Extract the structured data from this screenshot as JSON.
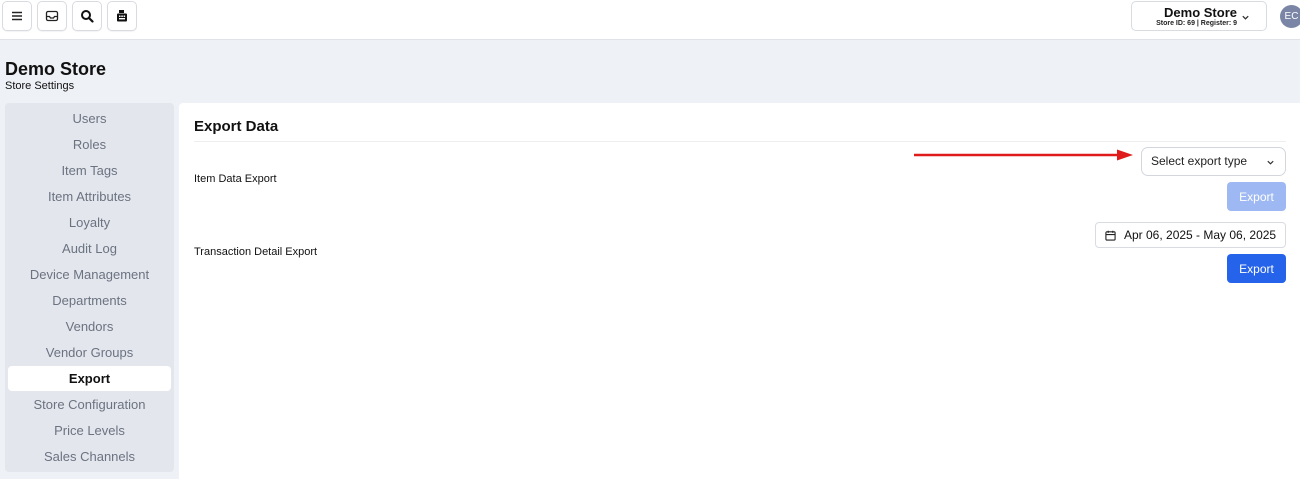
{
  "topbar": {
    "buttons": [
      {
        "icon": "menu-icon"
      },
      {
        "icon": "inbox-icon"
      },
      {
        "icon": "search-icon"
      },
      {
        "icon": "register-icon"
      }
    ],
    "store_name": "Demo Store",
    "store_meta": "Store ID: 69 | Register: 9",
    "avatar_initials": "EC"
  },
  "header": {
    "title": "Demo Store",
    "subtitle": "Store Settings"
  },
  "sidebar": {
    "items": [
      {
        "label": "Users"
      },
      {
        "label": "Roles"
      },
      {
        "label": "Item Tags"
      },
      {
        "label": "Item Attributes"
      },
      {
        "label": "Loyalty"
      },
      {
        "label": "Audit Log"
      },
      {
        "label": "Device Management"
      },
      {
        "label": "Departments"
      },
      {
        "label": "Vendors"
      },
      {
        "label": "Vendor Groups"
      },
      {
        "label": "Export"
      },
      {
        "label": "Store Configuration"
      },
      {
        "label": "Price Levels"
      },
      {
        "label": "Sales Channels"
      }
    ],
    "active": "Export"
  },
  "main": {
    "title": "Export Data",
    "item_export": {
      "label": "Item Data Export",
      "select_value": "Select export type",
      "button": "Export",
      "button_disabled": true
    },
    "transaction_export": {
      "label": "Transaction Detail Export",
      "date_range": "Apr 06, 2025 - May 06, 2025",
      "button": "Export"
    }
  },
  "colors": {
    "primary": "#2563eb",
    "primary_disabled": "#9db8f2",
    "annotation_arrow": "#e01b1b"
  }
}
